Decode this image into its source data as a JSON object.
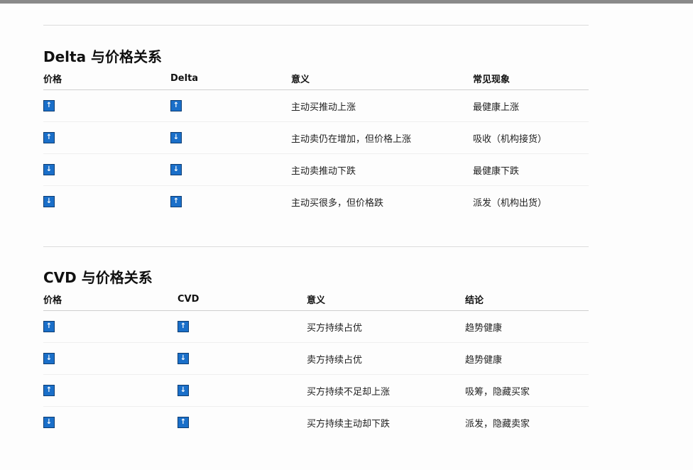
{
  "sections": [
    {
      "title": "Delta 与价格关系",
      "headers": [
        "价格",
        "Delta",
        "意义",
        "常见现象"
      ],
      "rows": [
        {
          "price": "up-arrow",
          "delta": "up-arrow",
          "meaning": "主动买推动上涨",
          "phenomenon": "最健康上涨"
        },
        {
          "price": "up-arrow",
          "delta": "down-arrow",
          "meaning": "主动卖仍在增加，但价格上涨",
          "phenomenon": "吸收（机构接货）"
        },
        {
          "price": "down-arrow",
          "delta": "down-arrow",
          "meaning": "主动卖推动下跌",
          "phenomenon": "最健康下跌"
        },
        {
          "price": "down-arrow",
          "delta": "up-arrow",
          "meaning": "主动买很多，但价格跌",
          "phenomenon": "派发（机构出货）"
        }
      ]
    },
    {
      "title": "CVD 与价格关系",
      "headers": [
        "价格",
        "CVD",
        "意义",
        "结论"
      ],
      "rows": [
        {
          "price": "up-arrow",
          "delta": "up-arrow",
          "meaning": "买方持续占优",
          "phenomenon": "趋势健康"
        },
        {
          "price": "down-arrow",
          "delta": "down-arrow",
          "meaning": "卖方持续占优",
          "phenomenon": "趋势健康"
        },
        {
          "price": "up-arrow",
          "delta": "down-arrow",
          "meaning": "买方持续不足却上涨",
          "phenomenon": "吸筹，隐藏买家"
        },
        {
          "price": "down-arrow",
          "delta": "up-arrow",
          "meaning": "买方持续主动却下跌",
          "phenomenon": "派发，隐藏卖家"
        }
      ]
    }
  ],
  "icons": {
    "up-arrow": "↑",
    "down-arrow": "↓"
  },
  "colors": {
    "arrow_bg": "#1a6fc9"
  }
}
